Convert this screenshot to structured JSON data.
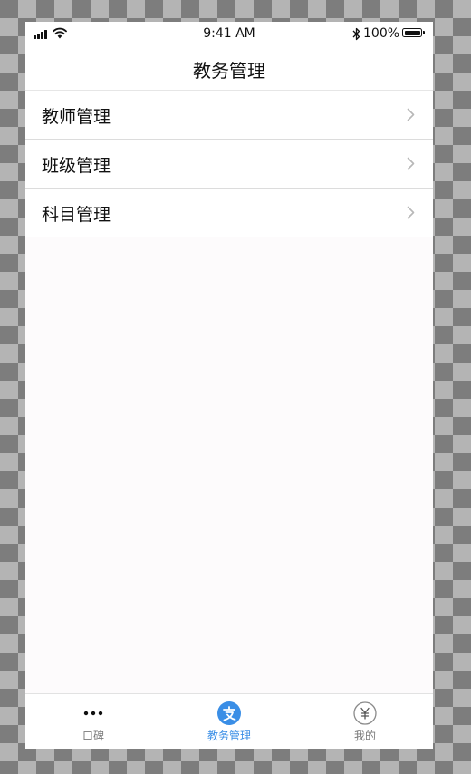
{
  "status_bar": {
    "time": "9:41 AM",
    "battery": "100%"
  },
  "nav": {
    "title": "教务管理"
  },
  "menu": {
    "items": [
      {
        "label": "教师管理"
      },
      {
        "label": "班级管理"
      },
      {
        "label": "科目管理"
      }
    ]
  },
  "tabs": [
    {
      "label": "口碑",
      "icon": "more-dots-icon",
      "active": false
    },
    {
      "label": "教务管理",
      "icon": "alipay-icon",
      "active": true
    },
    {
      "label": "我的",
      "icon": "yuan-icon",
      "active": false
    }
  ],
  "colors": {
    "accent": "#3a8ee6",
    "inactive": "#7a7a7a"
  }
}
